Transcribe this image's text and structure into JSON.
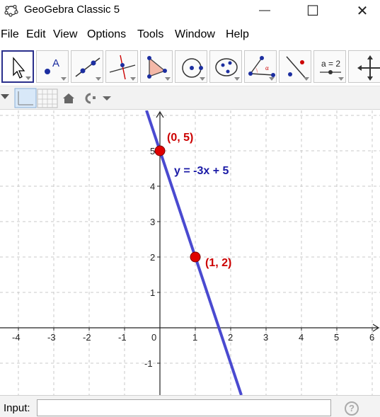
{
  "window": {
    "title": "GeoGebra Classic 5",
    "minimize": "—",
    "maximize": "☐",
    "close": "✕"
  },
  "menu": [
    "File",
    "Edit",
    "View",
    "Options",
    "Tools",
    "Window",
    "Help"
  ],
  "toolbar": {
    "tools": [
      {
        "name": "move-tool",
        "selected": true
      },
      {
        "name": "point-tool"
      },
      {
        "name": "line-tool"
      },
      {
        "name": "perpendicular-line-tool"
      },
      {
        "name": "polygon-tool"
      },
      {
        "name": "circle-tool"
      },
      {
        "name": "ellipse-tool"
      },
      {
        "name": "angle-tool"
      },
      {
        "name": "reflect-tool"
      },
      {
        "name": "slider-tool",
        "label": "a = 2"
      },
      {
        "name": "move-graphics-view-tool"
      }
    ]
  },
  "graphics": {
    "x_ticks": [
      "-4",
      "-3",
      "-2",
      "-1",
      "0",
      "1",
      "2",
      "3",
      "4",
      "5",
      "6"
    ],
    "y_ticks_pos": [
      "1",
      "2",
      "3",
      "4",
      "5"
    ],
    "y_ticks_neg": [
      "-1"
    ],
    "line": {
      "label": "y = -3x + 5",
      "slope": -3,
      "intercept": 5,
      "color": "#4a4ad0"
    },
    "points": [
      {
        "x": 0,
        "y": 5,
        "label": "(0, 5)"
      },
      {
        "x": 1,
        "y": 2,
        "label": "(1, 2)"
      }
    ],
    "point_color": "#e00000",
    "label_color": "#cc0000",
    "equation_color": "#1a1aa6"
  },
  "input_bar": {
    "label": "Input:",
    "value": "",
    "placeholder": "",
    "help": "?"
  }
}
